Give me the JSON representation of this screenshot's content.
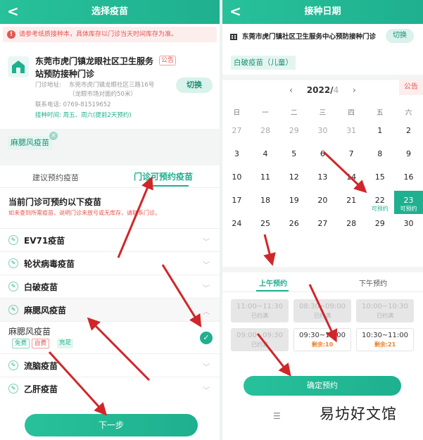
{
  "left": {
    "header": {
      "back": "<",
      "title": "选择疫苗"
    },
    "notice": "请参考纸质接种本，具体库存以门诊当天时间库存为准。",
    "clinic": {
      "name": "东莞市虎门镇龙眼社区卫生服务站预防接种门诊",
      "ad_tag": "公告",
      "address_label": "门诊地址:",
      "address_line1": "东莞市虎门镇龙眼社区三路16号",
      "address_line2": "（龙眼市场对面约50米）",
      "phone": "联系电话: 0769-81519652",
      "schedule": "接种时间: 周五、周六(提前2天预约)",
      "switch": "切换"
    },
    "selected_chip": "麻腮风疫苗",
    "chip_close": "×",
    "tabs": {
      "suggest": "建议预约疫苗",
      "available": "门诊可预约疫苗"
    },
    "section_title": "当前门诊可预约以下疫苗",
    "section_sub": "如未查到所需疫苗，说明门诊未放号或无库存，请联系门诊。",
    "vaccines": [
      {
        "name": "EV71疫苗"
      },
      {
        "name": "轮状病毒疫苗"
      },
      {
        "name": "白破疫苗"
      },
      {
        "name": "麻腮风疫苗"
      }
    ],
    "expanded": {
      "name": "麻腮风疫苗",
      "tag_free": "免费",
      "tag_self": "自费",
      "status": "充足",
      "check": "✓"
    },
    "vaccines_after": [
      {
        "name": "流脑疫苗"
      },
      {
        "name": "乙肝疫苗"
      }
    ],
    "next_button": "下一步"
  },
  "right": {
    "header": {
      "back": "<",
      "title": "接种日期"
    },
    "clinic_name": "东莞市虎门镇社区卫生服务中心预防接种门诊",
    "switch": "切换",
    "vaccine_chip": "白破疫苗（儿童）",
    "ad_tag": "公告",
    "month": {
      "prev": "‹",
      "year": "2022/",
      "mon": "4",
      "next": "›"
    },
    "weekdays": [
      "日",
      "一",
      "二",
      "三",
      "四",
      "五",
      "六"
    ],
    "days": [
      {
        "d": "27",
        "muted": true
      },
      {
        "d": "28",
        "muted": true
      },
      {
        "d": "29",
        "muted": true
      },
      {
        "d": "30",
        "muted": true
      },
      {
        "d": "31",
        "muted": true
      },
      {
        "d": "1"
      },
      {
        "d": "2"
      },
      {
        "d": "3"
      },
      {
        "d": "4"
      },
      {
        "d": "5"
      },
      {
        "d": "6"
      },
      {
        "d": "7"
      },
      {
        "d": "8"
      },
      {
        "d": "9"
      },
      {
        "d": "10"
      },
      {
        "d": "11"
      },
      {
        "d": "12"
      },
      {
        "d": "13"
      },
      {
        "d": "14"
      },
      {
        "d": "15"
      },
      {
        "d": "16"
      },
      {
        "d": "17"
      },
      {
        "d": "18"
      },
      {
        "d": "19"
      },
      {
        "d": "20"
      },
      {
        "d": "21"
      },
      {
        "d": "22",
        "sub": "可预约"
      },
      {
        "d": "23",
        "sub": "可预约",
        "selected": true
      },
      {
        "d": "24"
      },
      {
        "d": "25"
      },
      {
        "d": "26"
      },
      {
        "d": "27"
      },
      {
        "d": "28"
      },
      {
        "d": "29"
      },
      {
        "d": "30"
      }
    ],
    "tabs": {
      "am": "上午预约",
      "pm": "下午预约"
    },
    "slots": [
      {
        "time": "11:00~11:30",
        "status": "已约满",
        "full": true
      },
      {
        "time": "08:30~09:00",
        "status": "已约满",
        "full": true
      },
      {
        "time": "10:00~10:30",
        "status": "已约满",
        "full": true
      },
      {
        "time": "09:00~09:30",
        "status": "已约满",
        "full": true
      },
      {
        "time": "09:30~10:00",
        "status": "剩余:10",
        "full": false
      },
      {
        "time": "10:30~11:00",
        "status": "剩余:21",
        "full": false
      }
    ],
    "confirm_button": "确定预约",
    "menu_icon": "☰",
    "watermark": "易坊好文馆"
  },
  "colors": {
    "accent": "#1fb08f",
    "warn": "#e4574f",
    "remain": "#e8822e",
    "arrow": "#d0262a"
  }
}
